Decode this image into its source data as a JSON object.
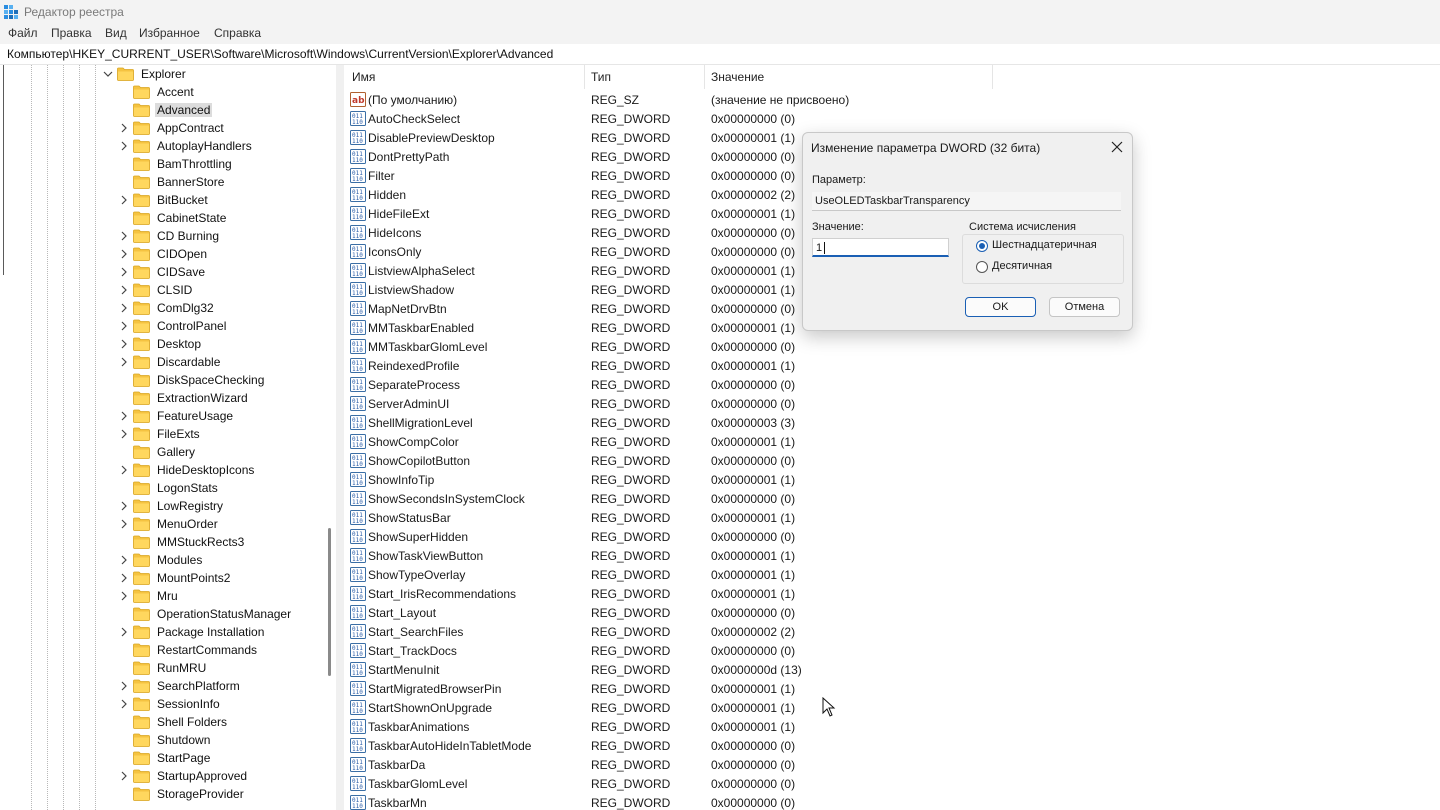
{
  "window": {
    "title": "Редактор реестра"
  },
  "menu": [
    "Файл",
    "Правка",
    "Вид",
    "Избранное",
    "Справка"
  ],
  "address": "Компьютер\\HKEY_CURRENT_USER\\Software\\Microsoft\\Windows\\CurrentVersion\\Explorer\\Advanced",
  "tree": {
    "parent": "Explorer",
    "children": [
      {
        "label": "Accent",
        "expandable": false
      },
      {
        "label": "Advanced",
        "expandable": false,
        "selected": true
      },
      {
        "label": "AppContract",
        "expandable": true
      },
      {
        "label": "AutoplayHandlers",
        "expandable": true
      },
      {
        "label": "BamThrottling",
        "expandable": false
      },
      {
        "label": "BannerStore",
        "expandable": false
      },
      {
        "label": "BitBucket",
        "expandable": true
      },
      {
        "label": "CabinetState",
        "expandable": false
      },
      {
        "label": "CD Burning",
        "expandable": true
      },
      {
        "label": "CIDOpen",
        "expandable": true
      },
      {
        "label": "CIDSave",
        "expandable": true
      },
      {
        "label": "CLSID",
        "expandable": true
      },
      {
        "label": "ComDlg32",
        "expandable": true
      },
      {
        "label": "ControlPanel",
        "expandable": true
      },
      {
        "label": "Desktop",
        "expandable": true
      },
      {
        "label": "Discardable",
        "expandable": true
      },
      {
        "label": "DiskSpaceChecking",
        "expandable": false
      },
      {
        "label": "ExtractionWizard",
        "expandable": false
      },
      {
        "label": "FeatureUsage",
        "expandable": true
      },
      {
        "label": "FileExts",
        "expandable": true
      },
      {
        "label": "Gallery",
        "expandable": false
      },
      {
        "label": "HideDesktopIcons",
        "expandable": true
      },
      {
        "label": "LogonStats",
        "expandable": false
      },
      {
        "label": "LowRegistry",
        "expandable": true
      },
      {
        "label": "MenuOrder",
        "expandable": true
      },
      {
        "label": "MMStuckRects3",
        "expandable": false
      },
      {
        "label": "Modules",
        "expandable": true
      },
      {
        "label": "MountPoints2",
        "expandable": true
      },
      {
        "label": "Mru",
        "expandable": true
      },
      {
        "label": "OperationStatusManager",
        "expandable": false
      },
      {
        "label": "Package Installation",
        "expandable": true
      },
      {
        "label": "RestartCommands",
        "expandable": false
      },
      {
        "label": "RunMRU",
        "expandable": false
      },
      {
        "label": "SearchPlatform",
        "expandable": true
      },
      {
        "label": "SessionInfo",
        "expandable": true
      },
      {
        "label": "Shell Folders",
        "expandable": false
      },
      {
        "label": "Shutdown",
        "expandable": false
      },
      {
        "label": "StartPage",
        "expandable": false
      },
      {
        "label": "StartupApproved",
        "expandable": true
      },
      {
        "label": "StorageProvider",
        "expandable": false
      }
    ]
  },
  "columns": {
    "name": "Имя",
    "type": "Тип",
    "value": "Значение"
  },
  "values": [
    {
      "name": "(По умолчанию)",
      "type": "REG_SZ",
      "data": "(значение не присвоено)",
      "icon": "string-value-icon"
    },
    {
      "name": "AutoCheckSelect",
      "type": "REG_DWORD",
      "data": "0x00000000 (0)",
      "icon": "binary-value-icon"
    },
    {
      "name": "DisablePreviewDesktop",
      "type": "REG_DWORD",
      "data": "0x00000001 (1)",
      "icon": "binary-value-icon"
    },
    {
      "name": "DontPrettyPath",
      "type": "REG_DWORD",
      "data": "0x00000000 (0)",
      "icon": "binary-value-icon"
    },
    {
      "name": "Filter",
      "type": "REG_DWORD",
      "data": "0x00000000 (0)",
      "icon": "binary-value-icon"
    },
    {
      "name": "Hidden",
      "type": "REG_DWORD",
      "data": "0x00000002 (2)",
      "icon": "binary-value-icon"
    },
    {
      "name": "HideFileExt",
      "type": "REG_DWORD",
      "data": "0x00000001 (1)",
      "icon": "binary-value-icon"
    },
    {
      "name": "HideIcons",
      "type": "REG_DWORD",
      "data": "0x00000000 (0)",
      "icon": "binary-value-icon"
    },
    {
      "name": "IconsOnly",
      "type": "REG_DWORD",
      "data": "0x00000000 (0)",
      "icon": "binary-value-icon"
    },
    {
      "name": "ListviewAlphaSelect",
      "type": "REG_DWORD",
      "data": "0x00000001 (1)",
      "icon": "binary-value-icon"
    },
    {
      "name": "ListviewShadow",
      "type": "REG_DWORD",
      "data": "0x00000001 (1)",
      "icon": "binary-value-icon"
    },
    {
      "name": "MapNetDrvBtn",
      "type": "REG_DWORD",
      "data": "0x00000000 (0)",
      "icon": "binary-value-icon"
    },
    {
      "name": "MMTaskbarEnabled",
      "type": "REG_DWORD",
      "data": "0x00000001 (1)",
      "icon": "binary-value-icon"
    },
    {
      "name": "MMTaskbarGlomLevel",
      "type": "REG_DWORD",
      "data": "0x00000000 (0)",
      "icon": "binary-value-icon"
    },
    {
      "name": "ReindexedProfile",
      "type": "REG_DWORD",
      "data": "0x00000001 (1)",
      "icon": "binary-value-icon"
    },
    {
      "name": "SeparateProcess",
      "type": "REG_DWORD",
      "data": "0x00000000 (0)",
      "icon": "binary-value-icon"
    },
    {
      "name": "ServerAdminUI",
      "type": "REG_DWORD",
      "data": "0x00000000 (0)",
      "icon": "binary-value-icon"
    },
    {
      "name": "ShellMigrationLevel",
      "type": "REG_DWORD",
      "data": "0x00000003 (3)",
      "icon": "binary-value-icon"
    },
    {
      "name": "ShowCompColor",
      "type": "REG_DWORD",
      "data": "0x00000001 (1)",
      "icon": "binary-value-icon"
    },
    {
      "name": "ShowCopilotButton",
      "type": "REG_DWORD",
      "data": "0x00000000 (0)",
      "icon": "binary-value-icon"
    },
    {
      "name": "ShowInfoTip",
      "type": "REG_DWORD",
      "data": "0x00000001 (1)",
      "icon": "binary-value-icon"
    },
    {
      "name": "ShowSecondsInSystemClock",
      "type": "REG_DWORD",
      "data": "0x00000000 (0)",
      "icon": "binary-value-icon"
    },
    {
      "name": "ShowStatusBar",
      "type": "REG_DWORD",
      "data": "0x00000001 (1)",
      "icon": "binary-value-icon"
    },
    {
      "name": "ShowSuperHidden",
      "type": "REG_DWORD",
      "data": "0x00000000 (0)",
      "icon": "binary-value-icon"
    },
    {
      "name": "ShowTaskViewButton",
      "type": "REG_DWORD",
      "data": "0x00000001 (1)",
      "icon": "binary-value-icon"
    },
    {
      "name": "ShowTypeOverlay",
      "type": "REG_DWORD",
      "data": "0x00000001 (1)",
      "icon": "binary-value-icon"
    },
    {
      "name": "Start_IrisRecommendations",
      "type": "REG_DWORD",
      "data": "0x00000001 (1)",
      "icon": "binary-value-icon"
    },
    {
      "name": "Start_Layout",
      "type": "REG_DWORD",
      "data": "0x00000000 (0)",
      "icon": "binary-value-icon"
    },
    {
      "name": "Start_SearchFiles",
      "type": "REG_DWORD",
      "data": "0x00000002 (2)",
      "icon": "binary-value-icon"
    },
    {
      "name": "Start_TrackDocs",
      "type": "REG_DWORD",
      "data": "0x00000000 (0)",
      "icon": "binary-value-icon"
    },
    {
      "name": "StartMenuInit",
      "type": "REG_DWORD",
      "data": "0x0000000d (13)",
      "icon": "binary-value-icon"
    },
    {
      "name": "StartMigratedBrowserPin",
      "type": "REG_DWORD",
      "data": "0x00000001 (1)",
      "icon": "binary-value-icon"
    },
    {
      "name": "StartShownOnUpgrade",
      "type": "REG_DWORD",
      "data": "0x00000001 (1)",
      "icon": "binary-value-icon"
    },
    {
      "name": "TaskbarAnimations",
      "type": "REG_DWORD",
      "data": "0x00000001 (1)",
      "icon": "binary-value-icon"
    },
    {
      "name": "TaskbarAutoHideInTabletMode",
      "type": "REG_DWORD",
      "data": "0x00000000 (0)",
      "icon": "binary-value-icon"
    },
    {
      "name": "TaskbarDa",
      "type": "REG_DWORD",
      "data": "0x00000000 (0)",
      "icon": "binary-value-icon"
    },
    {
      "name": "TaskbarGlomLevel",
      "type": "REG_DWORD",
      "data": "0x00000000 (0)",
      "icon": "binary-value-icon"
    },
    {
      "name": "TaskbarMn",
      "type": "REG_DWORD",
      "data": "0x00000000 (0)",
      "icon": "binary-value-icon"
    }
  ],
  "dialog": {
    "title": "Изменение параметра DWORD (32 бита)",
    "param_label": "Параметр:",
    "param_value": "UseOLEDTaskbarTransparency",
    "value_label": "Значение:",
    "value_input": "1",
    "base_label": "Система исчисления",
    "radio_hex": "Шестнадцатеричная",
    "radio_dec": "Десятичная",
    "selected_base": "hex",
    "ok": "OK",
    "cancel": "Отмена"
  },
  "colors": {
    "accent": "#1a5fb4",
    "folder": "#f5c341",
    "selection": "#dcdcdc"
  }
}
